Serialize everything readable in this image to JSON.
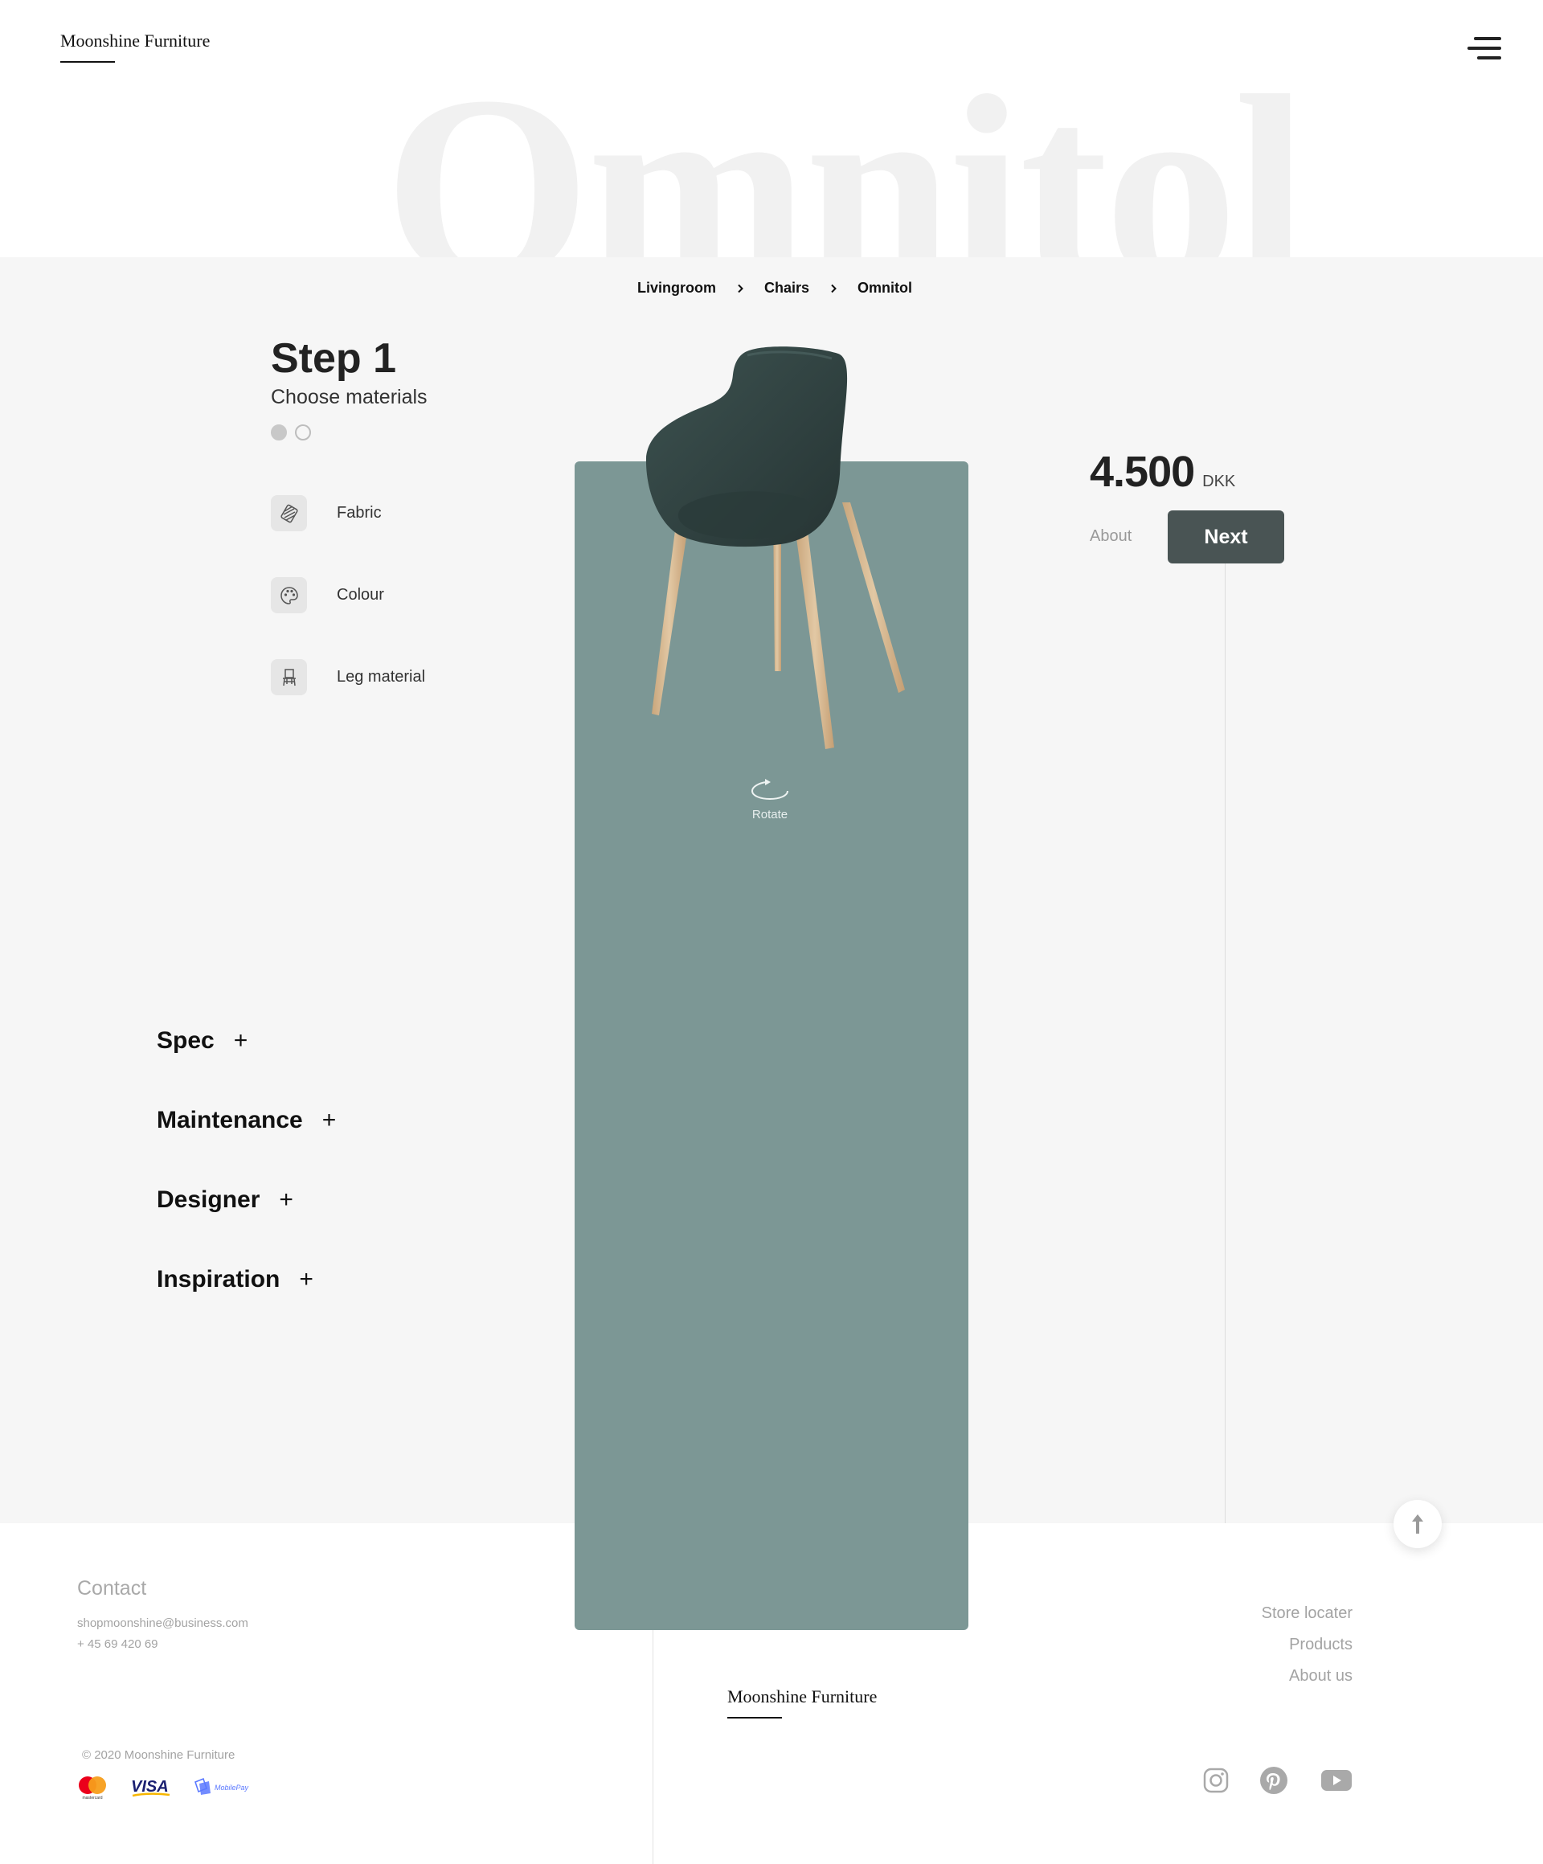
{
  "header": {
    "logo": "Moonshine Furniture",
    "hero_word": "Omnitol"
  },
  "breadcrumb": [
    "Livingroom",
    "Chairs",
    "Omnitol"
  ],
  "configurator": {
    "step_title": "Step 1",
    "step_subtitle": "Choose materials",
    "step_dots": {
      "current": 1,
      "total": 2
    },
    "materials": [
      {
        "label": "Fabric",
        "icon": "fabric-swatch-icon"
      },
      {
        "label": "Colour",
        "icon": "palette-icon"
      },
      {
        "label": "Leg material",
        "icon": "chair-legs-icon"
      }
    ]
  },
  "accordions": [
    "Spec",
    "Maintenance",
    "Designer",
    "Inspiration"
  ],
  "accordion_symbol": "+",
  "product": {
    "rotate_label": "Rotate",
    "panel_color": "#7c9795",
    "chair_fabric_color": "#2f403f",
    "chair_leg_color": "#d7b894"
  },
  "pricing": {
    "price": "4.500",
    "currency": "DKK",
    "about_label": "About",
    "next_label": "Next",
    "next_color": "#495454"
  },
  "footer": {
    "contact_title": "Contact",
    "email": "shopmoonshine@business.com",
    "phone": "+ 45 69 420 69",
    "copyright": "© 2020 Moonshine Furniture",
    "logo": "Moonshine Furniture",
    "links": [
      "Store locater",
      "Products",
      "About us"
    ],
    "payments": {
      "mastercard": "mastercard",
      "visa": "VISA",
      "mobilepay": "MobilePay"
    },
    "socials": [
      "instagram-icon",
      "pinterest-icon",
      "youtube-icon"
    ]
  }
}
